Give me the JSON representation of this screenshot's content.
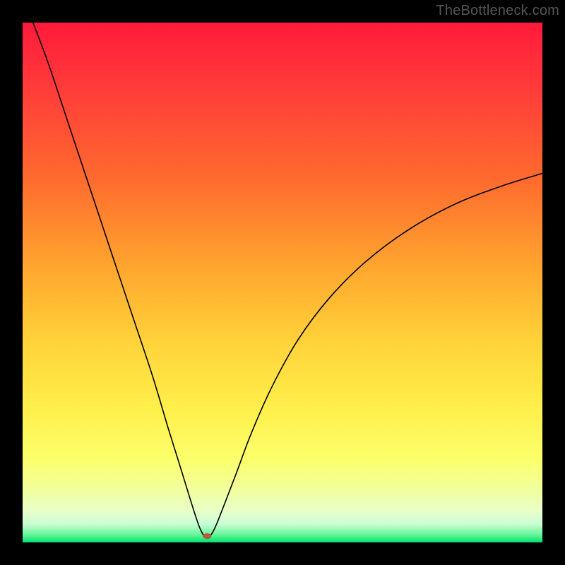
{
  "watermark": "TheBottleneck.com",
  "chart_data": {
    "type": "line",
    "title": "",
    "xlabel": "",
    "ylabel": "",
    "xlim": [
      0,
      100
    ],
    "ylim": [
      0,
      100
    ],
    "background": {
      "type": "vertical-gradient",
      "stops": [
        {
          "offset": 0.0,
          "color": "#ff1a3a"
        },
        {
          "offset": 0.12,
          "color": "#ff3a3a"
        },
        {
          "offset": 0.3,
          "color": "#ff6a2e"
        },
        {
          "offset": 0.48,
          "color": "#ffa92e"
        },
        {
          "offset": 0.62,
          "color": "#ffd43a"
        },
        {
          "offset": 0.74,
          "color": "#ffef4a"
        },
        {
          "offset": 0.84,
          "color": "#fbff6a"
        },
        {
          "offset": 0.9,
          "color": "#f1ff9e"
        },
        {
          "offset": 0.94,
          "color": "#e8ffc8"
        },
        {
          "offset": 0.965,
          "color": "#c8ffd4"
        },
        {
          "offset": 0.985,
          "color": "#68f59a"
        },
        {
          "offset": 1.0,
          "color": "#00e36e"
        }
      ]
    },
    "marker": {
      "x": 35.5,
      "y": 1.2,
      "color": "#b5593f",
      "rx": 6,
      "ry": 4
    },
    "series": [
      {
        "name": "bottleneck-curve",
        "color": "#000000",
        "width": 1.6,
        "points": [
          {
            "x": 2.0,
            "y": 100.0
          },
          {
            "x": 5.0,
            "y": 92.0
          },
          {
            "x": 9.0,
            "y": 80.0
          },
          {
            "x": 13.0,
            "y": 68.0
          },
          {
            "x": 17.0,
            "y": 56.0
          },
          {
            "x": 21.0,
            "y": 44.0
          },
          {
            "x": 25.0,
            "y": 32.0
          },
          {
            "x": 28.0,
            "y": 22.0
          },
          {
            "x": 30.5,
            "y": 14.0
          },
          {
            "x": 32.5,
            "y": 7.5
          },
          {
            "x": 34.0,
            "y": 3.0
          },
          {
            "x": 35.0,
            "y": 1.2
          },
          {
            "x": 36.0,
            "y": 1.2
          },
          {
            "x": 37.0,
            "y": 2.8
          },
          {
            "x": 38.5,
            "y": 6.5
          },
          {
            "x": 41.0,
            "y": 13.0
          },
          {
            "x": 44.0,
            "y": 21.0
          },
          {
            "x": 48.0,
            "y": 30.0
          },
          {
            "x": 53.0,
            "y": 39.0
          },
          {
            "x": 59.0,
            "y": 47.0
          },
          {
            "x": 66.0,
            "y": 54.0
          },
          {
            "x": 74.0,
            "y": 60.0
          },
          {
            "x": 83.0,
            "y": 65.0
          },
          {
            "x": 92.0,
            "y": 68.5
          },
          {
            "x": 100.0,
            "y": 71.0
          }
        ]
      }
    ]
  }
}
